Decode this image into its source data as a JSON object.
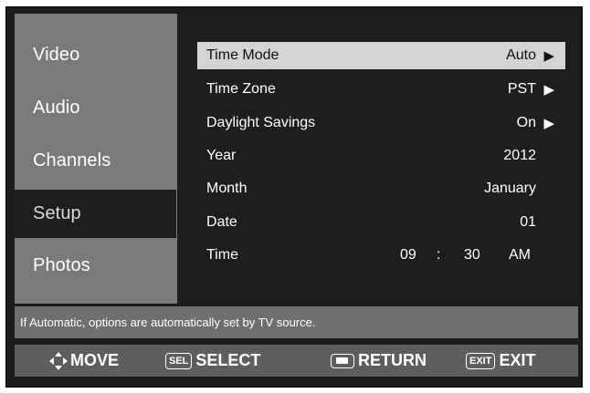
{
  "sidebar": {
    "items": [
      {
        "label": "Video"
      },
      {
        "label": "Audio"
      },
      {
        "label": "Channels"
      },
      {
        "label": "Setup"
      },
      {
        "label": "Photos"
      }
    ],
    "active": "Setup"
  },
  "settings": {
    "time_mode": {
      "label": "Time Mode",
      "value": "Auto",
      "arrow": "▶"
    },
    "time_zone": {
      "label": "Time Zone",
      "value": "PST",
      "arrow": "▶"
    },
    "daylight_savings": {
      "label": "Daylight Savings",
      "value": "On",
      "arrow": "▶"
    },
    "year": {
      "label": "Year",
      "value": "2012"
    },
    "month": {
      "label": "Month",
      "value": "January"
    },
    "date": {
      "label": "Date",
      "value": "01"
    },
    "time": {
      "label": "Time",
      "hour": "09",
      "separator": ":",
      "minute": "30",
      "ampm": "AM"
    }
  },
  "help_text": "If Automatic, options are automatically set by TV source.",
  "footer": {
    "move_label": "MOVE",
    "sel_tag": "SEL",
    "select_label": "SELECT",
    "return_label": "RETURN",
    "exit_tag": "EXIT",
    "exit_label": "EXIT"
  },
  "colors": {
    "frame": "#1c1c1c",
    "sidebar_bg": "#7a7a7a",
    "content_bg": "#1e1e1e",
    "selected_row": "#d4d4d4",
    "help_bg": "#6f6f6f",
    "footer_bg": "#5e5e5e"
  }
}
